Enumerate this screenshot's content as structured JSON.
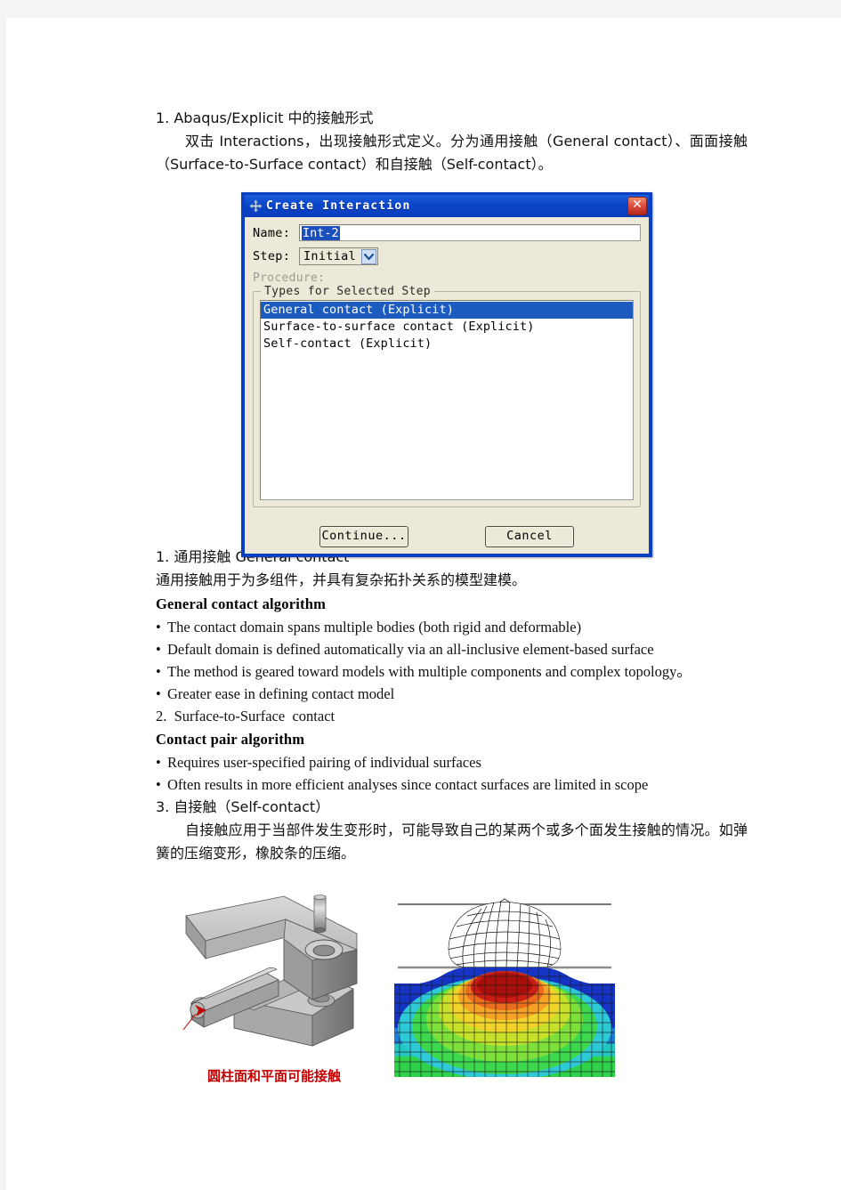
{
  "document": {
    "sections": [
      {
        "heading": "1. Abaqus/Explicit  中的接触形式",
        "paragraph": "双击 Interactions，出现接触形式定义。分为通用接触（General contact）、面面接触（Surface-to-Surface contact）和自接触（Self-contact）。"
      }
    ],
    "section1": {
      "title": "1.  通用接触  General contact",
      "chinese_desc": "通用接触用于为多组件，并具有复杂拓扑关系的模型建模。",
      "algorithm_heading": "General contact algorithm",
      "bullets": [
        "The contact domain spans multiple bodies (both rigid and deformable)",
        "Default domain is defined automatically via an all-inclusive element-based surface",
        "The method is geared toward models with multiple components and complex topology。",
        "Greater ease in defining contact model"
      ]
    },
    "section2": {
      "title": "2.  Surface-to-Surface  contact",
      "algorithm_heading": "Contact pair algorithm",
      "bullets": [
        "Requires user-specified pairing of individual surfaces",
        "Often results in more efficient analyses since contact surfaces are limited in scope"
      ]
    },
    "section3": {
      "title": "3.  自接触（Self-contact）",
      "paragraph": "自接触应用于当部件发生变形时，可能导致自己的某两个或多个面发生接触的情况。如弹簧的压缩变形，橡胶条的压缩。"
    },
    "figures": {
      "cad_caption": "圆柱面和平面可能接触",
      "cad_alt": "3D CAD model of a pin in a slotted plate with red arrow annotation",
      "fea_alt": "FEA contour plot of a meshed sphere indenting a deformable block"
    }
  },
  "dialog": {
    "title": "Create Interaction",
    "icon": "abaqus-move-icon",
    "close_label": "✕",
    "fields": {
      "name_label": "Name:",
      "name_value": "Int-2",
      "step_label": "Step:",
      "step_value": "Initial",
      "procedure_label": "Procedure:"
    },
    "group": {
      "legend": "Types for Selected Step",
      "items": [
        {
          "label": "General contact (Explicit)",
          "selected": true
        },
        {
          "label": "Surface-to-surface contact (Explicit)",
          "selected": false
        },
        {
          "label": "Self-contact (Explicit)",
          "selected": false
        }
      ]
    },
    "buttons": {
      "continue": "Continue...",
      "cancel": "Cancel"
    },
    "colors": {
      "titlebar": "#0a3fc4",
      "face": "#ece9d8",
      "selection": "#1c5bbf",
      "close": "#d9483b"
    }
  }
}
